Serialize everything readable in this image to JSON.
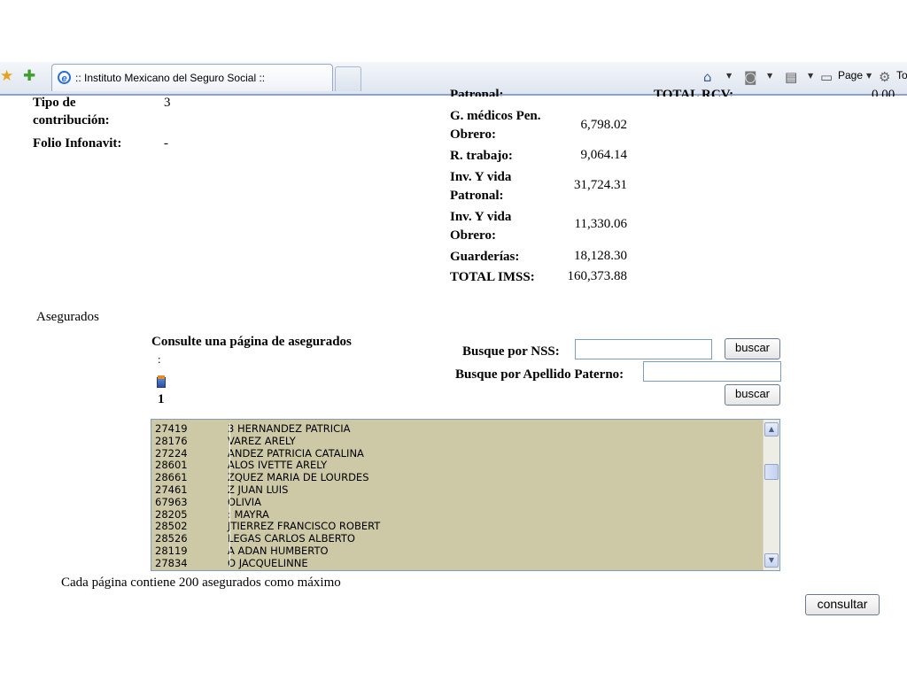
{
  "browser": {
    "tab_title": ":: Instituto Mexicano del Seguro Social ::",
    "page_menu": "Page",
    "tools_menu_partial": "To"
  },
  "info_left": {
    "tipo_label_1": "Tipo de",
    "tipo_label_2": "contribución:",
    "tipo_value": "3",
    "folio_label": "Folio Infonavit:",
    "folio_value": "-"
  },
  "imss": {
    "clipped_top_label": "Patronal:",
    "clipped_right_label": "TOTAL RCV:",
    "clipped_right_value": "0.00",
    "rows": [
      {
        "label_1": "G. médicos Pen.",
        "label_2": "Obrero:",
        "value": "6,798.02"
      },
      {
        "label_1": "R. trabajo:",
        "label_2": "",
        "value": "9,064.14"
      },
      {
        "label_1": "Inv. Y vida",
        "label_2": "Patronal:",
        "value": "31,724.31"
      },
      {
        "label_1": "Inv. Y vida",
        "label_2": "Obrero:",
        "value": "11,330.06"
      },
      {
        "label_1": "Guarderías:",
        "label_2": "",
        "value": "18,128.30"
      },
      {
        "label_1": "TOTAL IMSS:",
        "label_2": "",
        "value": "160,373.88"
      }
    ]
  },
  "asegurados": {
    "section_title": "Asegurados",
    "consulte_label": "Consulte una página de asegurados",
    "colon": ":",
    "page_number": "1",
    "nss_label": "Busque por NSS:",
    "nss_value": "",
    "apellido_label": "Busque por Apellido Paterno:",
    "apellido_value": "",
    "buscar_label": "buscar",
    "list": [
      {
        "nss": "27419",
        "name": "3 HERNANDEZ PATRICIA"
      },
      {
        "nss": "28176",
        "name": "VAREZ ARELY"
      },
      {
        "nss": "27224",
        "name": "ANDEZ PATRICIA CATALINA"
      },
      {
        "nss": "28601",
        "name": "ALOS IVETTE ARELY"
      },
      {
        "nss": "28661",
        "name": "ZQUEZ MARIA DE LOURDES"
      },
      {
        "nss": "27461",
        "name": "Z JUAN LUIS"
      },
      {
        "nss": "67963",
        "name": "OLIVIA"
      },
      {
        "nss": "28205",
        "name": ": MAYRA"
      },
      {
        "nss": "28502",
        "name": "JTIERREZ FRANCISCO ROBERT"
      },
      {
        "nss": "28526",
        "name": "LEGAS CARLOS ALBERTO"
      },
      {
        "nss": "28119",
        "name": "A ADAN HUMBERTO"
      },
      {
        "nss": "27834",
        "name": "O JACQUELINNE"
      }
    ],
    "footer_note": "Cada página contiene 200 asegurados como máximo",
    "consultar_label": "consultar"
  }
}
